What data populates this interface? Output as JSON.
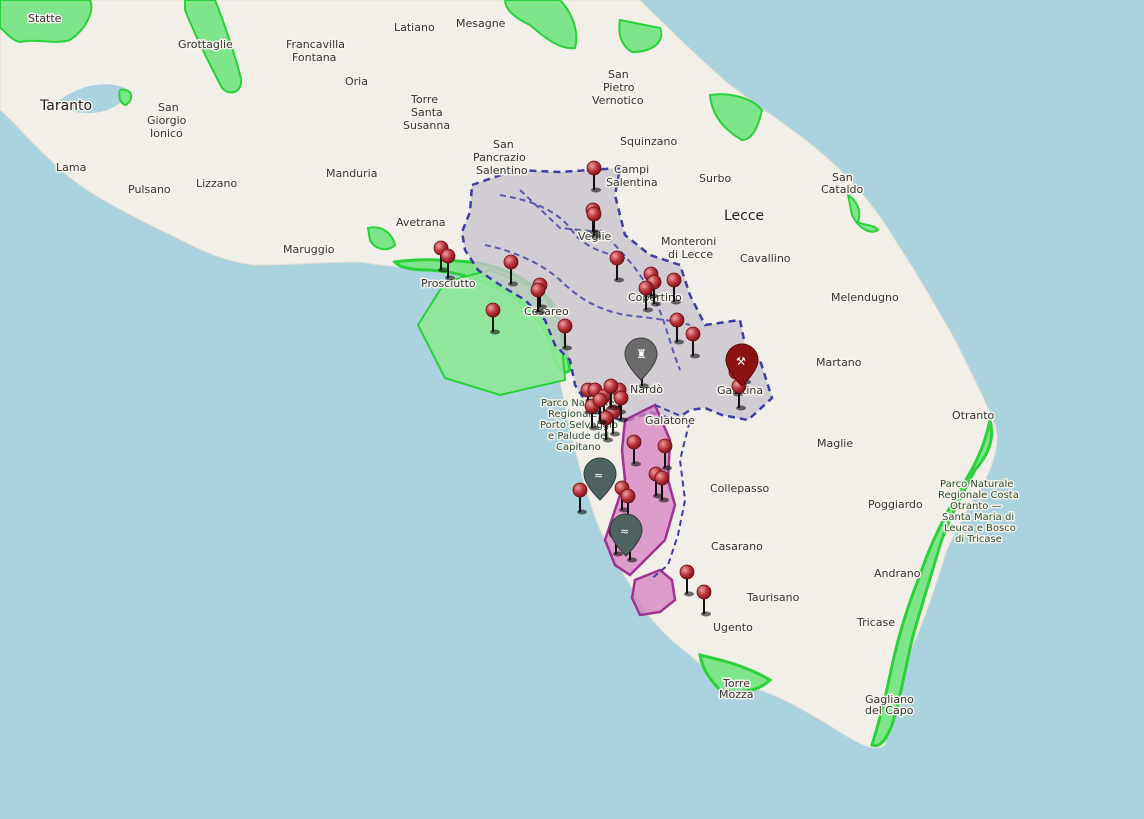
{
  "map": {
    "colors": {
      "sea": "#aad3df",
      "land": "#f2efe9",
      "park_fill": "#7fe58a",
      "park_stroke": "#2ad13a",
      "study_area_fill": "#c8c4cc",
      "study_area_stroke": "#3b3fa3",
      "protected_fill": "#d580c0",
      "protected_stroke": "#a0338f",
      "marker_fill": "#b8333a",
      "marker_dark": "#7a1010",
      "poi_dark": "#4a5a5a"
    },
    "labels": [
      {
        "id": "statte",
        "text": "Statte"
      },
      {
        "id": "grottaglie",
        "text": "Grottaglie"
      },
      {
        "id": "francavilla1",
        "text": "Francavilla"
      },
      {
        "id": "francavilla2",
        "text": "Fontana"
      },
      {
        "id": "latiano",
        "text": "Latiano"
      },
      {
        "id": "mesagne",
        "text": "Mesagne"
      },
      {
        "id": "taranto",
        "text": "Taranto"
      },
      {
        "id": "oria",
        "text": "Oria"
      },
      {
        "id": "sanpietro1",
        "text": "San"
      },
      {
        "id": "sanpietro2",
        "text": "Pietro"
      },
      {
        "id": "sanpietro3",
        "text": "Vernotico"
      },
      {
        "id": "sangiorgio1",
        "text": "San"
      },
      {
        "id": "sangiorgio2",
        "text": "Giorgio"
      },
      {
        "id": "sangiorgio3",
        "text": "Ionico"
      },
      {
        "id": "torre1",
        "text": "Torre"
      },
      {
        "id": "torre2",
        "text": "Santa"
      },
      {
        "id": "torre3",
        "text": "Susanna"
      },
      {
        "id": "squinzano",
        "text": "Squinzano"
      },
      {
        "id": "lama",
        "text": "Lama"
      },
      {
        "id": "sanpancrazio1",
        "text": "San"
      },
      {
        "id": "sanpancrazio2",
        "text": "Pancrazio"
      },
      {
        "id": "sanpancrazio3",
        "text": "Salentino"
      },
      {
        "id": "manduria",
        "text": "Manduria"
      },
      {
        "id": "campi1",
        "text": "Campi"
      },
      {
        "id": "campi2",
        "text": "Salentina"
      },
      {
        "id": "pulsano",
        "text": "Pulsano"
      },
      {
        "id": "lizzano",
        "text": "Lizzano"
      },
      {
        "id": "surbo",
        "text": "Surbo"
      },
      {
        "id": "sancataldo1",
        "text": "San"
      },
      {
        "id": "sancataldo2",
        "text": "Cataldo"
      },
      {
        "id": "lecce",
        "text": "Lecce"
      },
      {
        "id": "avetrana",
        "text": "Avetrana"
      },
      {
        "id": "veglie",
        "text": "Veglie"
      },
      {
        "id": "monteroni1",
        "text": "Monteroni"
      },
      {
        "id": "monteroni2",
        "text": "di Lecce"
      },
      {
        "id": "maruggio",
        "text": "Maruggio"
      },
      {
        "id": "cavallino",
        "text": "Cavallino"
      },
      {
        "id": "prosciutto",
        "text": "Prosciutto"
      },
      {
        "id": "copertino",
        "text": "Copertino"
      },
      {
        "id": "melendugno",
        "text": "Melendugno"
      },
      {
        "id": "cesareo",
        "text": "Cesareo"
      },
      {
        "id": "martano",
        "text": "Martano"
      },
      {
        "id": "nardo",
        "text": "Nardò"
      },
      {
        "id": "galatina",
        "text": "Galatina"
      },
      {
        "id": "otranto",
        "text": "Otranto"
      },
      {
        "id": "galatone",
        "text": "Galatone"
      },
      {
        "id": "maglie",
        "text": "Maglie"
      },
      {
        "id": "collepasso",
        "text": "Collepasso"
      },
      {
        "id": "poggiardo",
        "text": "Poggiardo"
      },
      {
        "id": "casarano",
        "text": "Casarano"
      },
      {
        "id": "andrano",
        "text": "Andrano"
      },
      {
        "id": "taurisano",
        "text": "Taurisano"
      },
      {
        "id": "ugento",
        "text": "Ugento"
      },
      {
        "id": "tricase",
        "text": "Tricase"
      },
      {
        "id": "torremozza1",
        "text": "Torre"
      },
      {
        "id": "torremozza2",
        "text": "Mozza"
      },
      {
        "id": "gagliano1",
        "text": "Gagliano"
      },
      {
        "id": "gagliano2",
        "text": "del Capo"
      }
    ],
    "park_labels": [
      {
        "id": "portoselvaggio",
        "lines": [
          "Parco Naturale",
          "Regionale di",
          "Porto Selvaggio",
          "e Palude del",
          "Capitano"
        ]
      },
      {
        "id": "otranto_park",
        "lines": [
          "Parco Naturale",
          "Regionale Costa",
          "Otranto —",
          "Santa Maria di",
          "Leuca e Bosco",
          "di Tricase"
        ]
      }
    ],
    "marker_count": 42
  }
}
